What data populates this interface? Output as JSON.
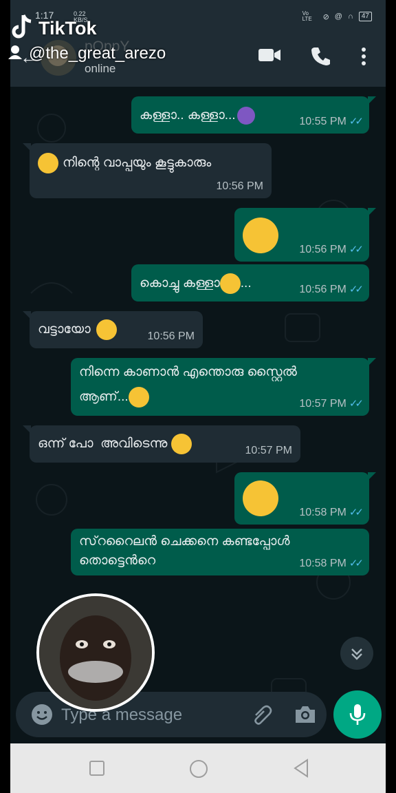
{
  "status_bar": {
    "time": "1:17",
    "network_speed": "0.22\nKB/S",
    "carrier": "Vo LTE",
    "battery": "47"
  },
  "header": {
    "contact_name": "pOppY",
    "contact_status": "online"
  },
  "watermark": {
    "brand": "TikTok",
    "username": "@the_great_arezo"
  },
  "messages": [
    {
      "direction": "out",
      "text": "കള്ളാ.. കള്ളാ...",
      "emoji": "woman-gesturing-no",
      "time": "10:55 PM",
      "read": true
    },
    {
      "direction": "in",
      "text": "നിന്റെ വാപ്പയും കൂട്ടുകാരും",
      "emoji": "face-with-monocle",
      "time": "10:56 PM"
    },
    {
      "direction": "out",
      "text": "",
      "emoji": "fearful-face",
      "time": "10:56 PM",
      "read": true
    },
    {
      "direction": "out",
      "text": "കൊച്ചു കള്ളാ",
      "suffix": "...",
      "emoji": "relieved-face",
      "time": "10:56 PM",
      "read": true
    },
    {
      "direction": "in",
      "text": "വട്ടായോ",
      "emoji": "thinking-face",
      "time": "10:56 PM"
    },
    {
      "direction": "out",
      "text": "നിന്നെ കാണാൻ എന്തൊരു സ്റ്റൈൽ",
      "text2": "ആണ്...",
      "emoji": "nerd-face",
      "time": "10:57 PM",
      "read": true
    },
    {
      "direction": "in",
      "text": "ഒന്ന് പോ  അവിടെന്നു",
      "emoji": "winking-face",
      "time": "10:57 PM"
    },
    {
      "direction": "out",
      "text": "",
      "emoji": "face-with-hand-over-mouth",
      "time": "10:58 PM",
      "read": true
    },
    {
      "direction": "out",
      "text": "സ്‌ററൈലൻ ചെക്കനെ കണ്ടപ്പോൾ",
      "text2": "തൊട്ടെൻറെ",
      "time": "10:58 PM",
      "read": true
    }
  ],
  "composer": {
    "placeholder": "Type a message"
  },
  "colors": {
    "outgoing_bubble": "#005c4b",
    "incoming_bubble": "#1f2c34",
    "accent": "#00a884",
    "read_ticks": "#53bdeb",
    "background": "#0b1519"
  }
}
